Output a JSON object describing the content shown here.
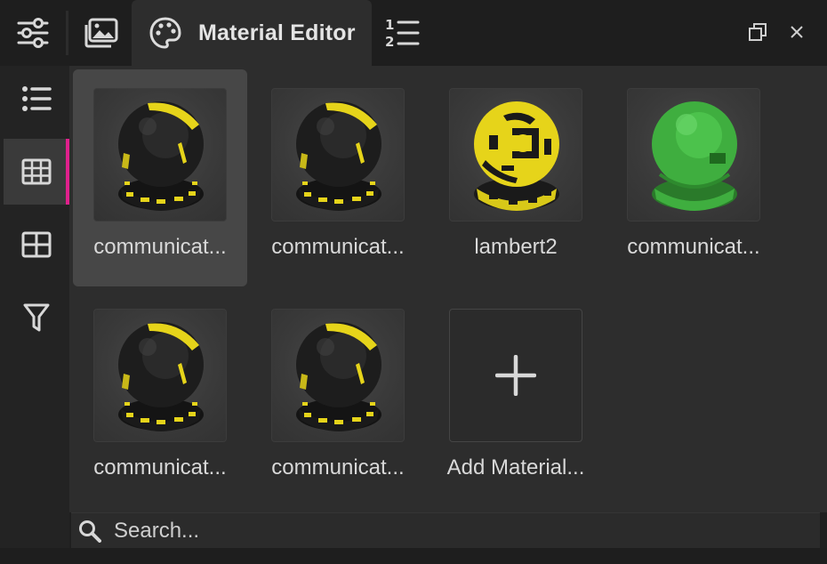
{
  "tabs": {
    "settings_icon": "sliders-icon",
    "gallery_icon": "image-icon",
    "active_label": "Material Editor",
    "active_icon": "palette-icon",
    "numbered_icon": "numbered-list-icon"
  },
  "window": {
    "restore_icon": "restore-icon",
    "close_icon": "close-icon"
  },
  "sidebar": {
    "items": [
      {
        "id": "list",
        "icon": "list-view-icon",
        "active": false
      },
      {
        "id": "grid",
        "icon": "grid-view-icon",
        "active": true
      },
      {
        "id": "tiles",
        "icon": "tile-view-icon",
        "active": false
      },
      {
        "id": "filter",
        "icon": "filter-icon",
        "active": false
      }
    ],
    "accent": "#e0208c"
  },
  "materials": [
    {
      "label": "communicat...",
      "style": "black-yellow",
      "selected": true
    },
    {
      "label": "communicat...",
      "style": "black-yellow",
      "selected": false
    },
    {
      "label": "lambert2",
      "style": "yellow-black",
      "selected": false
    },
    {
      "label": "communicat...",
      "style": "green",
      "selected": false
    },
    {
      "label": "communicat...",
      "style": "black-yellow",
      "selected": false
    },
    {
      "label": "communicat...",
      "style": "black-yellow",
      "selected": false
    }
  ],
  "add_material": {
    "label": "Add Material...",
    "icon": "plus-icon"
  },
  "search": {
    "placeholder": "Search...",
    "value": "",
    "icon": "search-icon"
  },
  "colors": {
    "yellow": "#e6d41a",
    "black": "#1a1a1a",
    "green": "#3fae3f",
    "panel": "#2d2d2d"
  }
}
